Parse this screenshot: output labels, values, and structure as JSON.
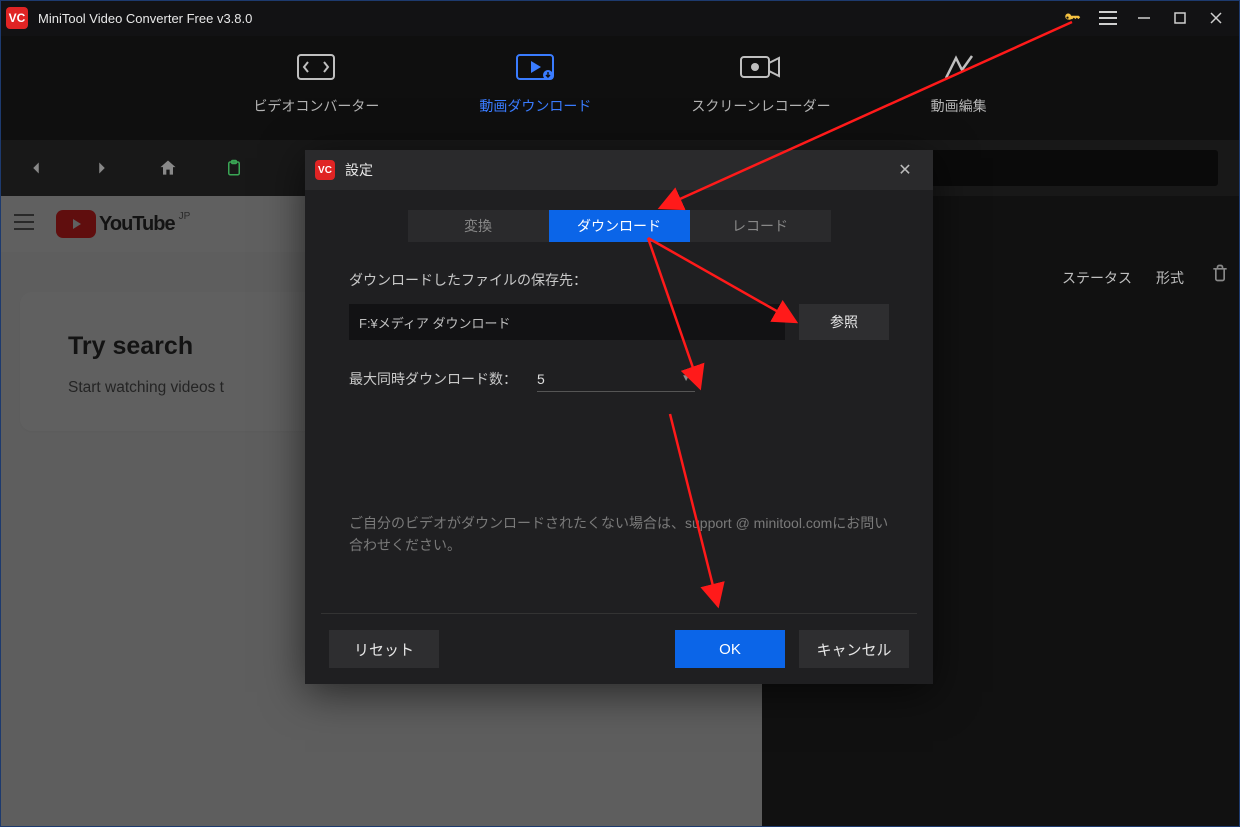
{
  "window": {
    "title": "MiniTool Video Converter Free v3.8.0"
  },
  "nav": {
    "items": [
      {
        "label": "ビデオコンバーター"
      },
      {
        "label": "動画ダウンロード"
      },
      {
        "label": "スクリーンレコーダー"
      },
      {
        "label": "動画編集"
      }
    ]
  },
  "youtube": {
    "brand": "YouTube",
    "region": "JP",
    "card_title": "Try search",
    "card_subtitle": "Start watching videos t"
  },
  "right_panel": {
    "col_status": "ステータス",
    "col_format": "形式"
  },
  "dialog": {
    "title": "設定",
    "tabs": {
      "convert": "変換",
      "download": "ダウンロード",
      "record": "レコード"
    },
    "save_label": "ダウンロードしたファイルの保存先：",
    "save_path": "F:¥メディア ダウンロード",
    "browse": "参照",
    "max_label": "最大同時ダウンロード数：",
    "max_value": "5",
    "support_note": "ご自分のビデオがダウンロードされたくない場合は、support @ minitool.comにお問い合わせください。",
    "reset": "リセット",
    "ok": "OK",
    "cancel": "キャンセル"
  }
}
